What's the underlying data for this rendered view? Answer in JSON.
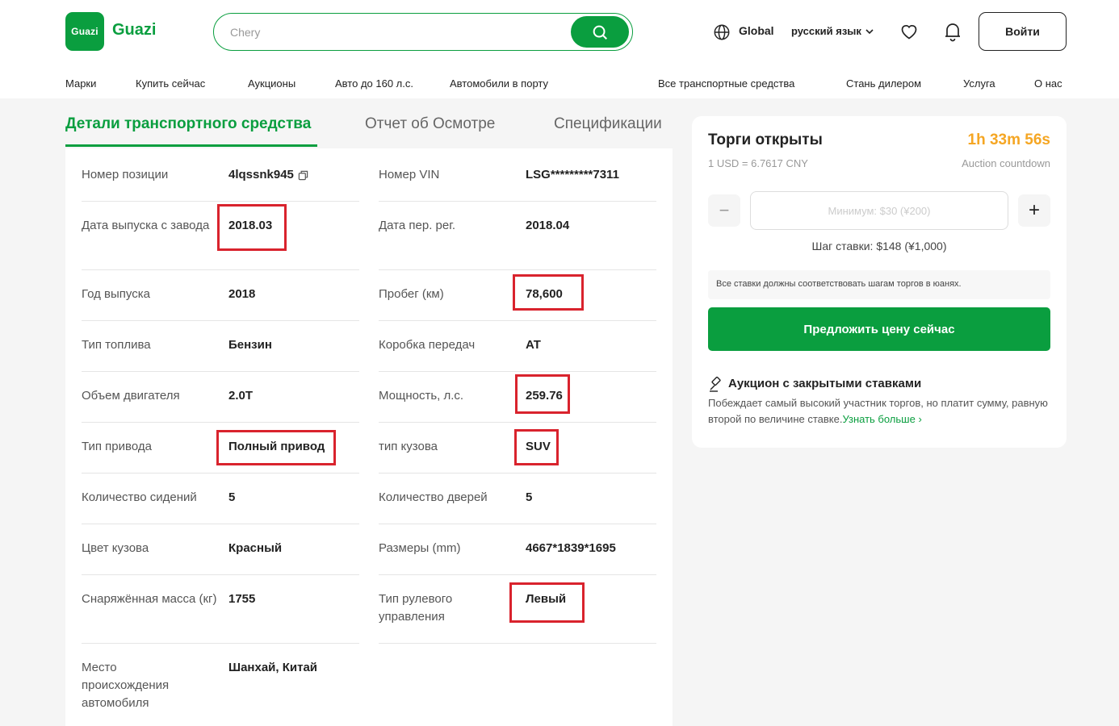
{
  "header": {
    "logo_box": "Guazi",
    "logo_text": "Guazi",
    "search_value": "",
    "search_placeholder": "Chery",
    "global_label": "Global",
    "language": "русский язык",
    "login_label": "Войти"
  },
  "nav": [
    "Марки",
    "Купить сейчас",
    "Аукционы",
    "Авто до 160 л.с.",
    "Автомобили в порту",
    "Все транспортные средства",
    "Стань дилером",
    "Услуга",
    "О нас"
  ],
  "tabs": [
    "Детали транспортного средства",
    "Отчет об Осмотре",
    "Спецификации"
  ],
  "details": {
    "left": [
      {
        "label": "Номер позиции",
        "value": "4lqssnk945"
      },
      {
        "label": "Дата выпуска с завода",
        "value": "2018.03"
      },
      {
        "label": "Год выпуска",
        "value": "2018"
      },
      {
        "label": "Тип топлива",
        "value": "Бензин"
      },
      {
        "label": "Объем двигателя",
        "value": "2.0T"
      },
      {
        "label": "Тип привода",
        "value": "Полный привод"
      },
      {
        "label": "Количество сидений",
        "value": "5"
      },
      {
        "label": "Цвет кузова",
        "value": "Красный"
      },
      {
        "label": "Снаряжённая масса (кг)",
        "value": "1755"
      },
      {
        "label": "Место происхождения автомобиля",
        "value": "Шанхай, Китай"
      }
    ],
    "right": [
      {
        "label": "Номер VIN",
        "value": "LSG*********7311"
      },
      {
        "label": "Дата пер. рег.",
        "value": "2018.04"
      },
      {
        "label": "Пробег (км)",
        "value": "78,600"
      },
      {
        "label": "Коробка передач",
        "value": "AT"
      },
      {
        "label": "Мощность, л.с.",
        "value": "259.76"
      },
      {
        "label": "тип кузова",
        "value": "SUV"
      },
      {
        "label": "Количество дверей",
        "value": "5"
      },
      {
        "label": "Размеры (mm)",
        "value": "4667*1839*1695"
      },
      {
        "label": "Тип рулевого управления",
        "value": "Левый"
      }
    ]
  },
  "auction": {
    "title": "Торги открыты",
    "timer": "1h 33m 56s",
    "rate": "1 USD = 6.7617 CNY",
    "countdown_label": "Auction countdown",
    "bid_placeholder": "Минимум: $30 (¥200)",
    "step": "Шаг ставки: $148 (¥1,000)",
    "note": "Все ставки должны соответствовать шагам торгов в юанях.",
    "bid_button": "Предложить цену сейчас",
    "sealed_title": "Аукцион с закрытыми ставками",
    "sealed_desc": "Побеждает самый высокий участник торгов, но платит сумму, равную второй по величине ставке.",
    "learn_more": "Узнать больше ›"
  },
  "colors": {
    "brand": "#0a9e3f",
    "timer": "#f5a623",
    "highlight": "#d9232d"
  }
}
